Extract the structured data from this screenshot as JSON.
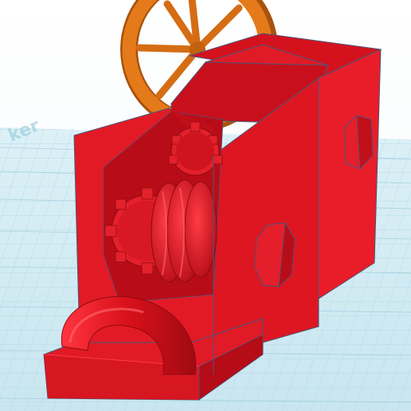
{
  "scene": {
    "description_label": "",
    "colors": {
      "sky": "#ffffff",
      "grid_base": "#d7eef5",
      "grid_line": "#a9d3e2",
      "grid_major": "#8fc2d6",
      "red_light": "#e8202c",
      "red_mid": "#c8101c",
      "red_dark": "#8f0a12",
      "edge": "#4b5678",
      "orange": "#e57a1a",
      "orange_dark": "#a9520c"
    },
    "grid_watermark": "tinkercad-grid"
  }
}
